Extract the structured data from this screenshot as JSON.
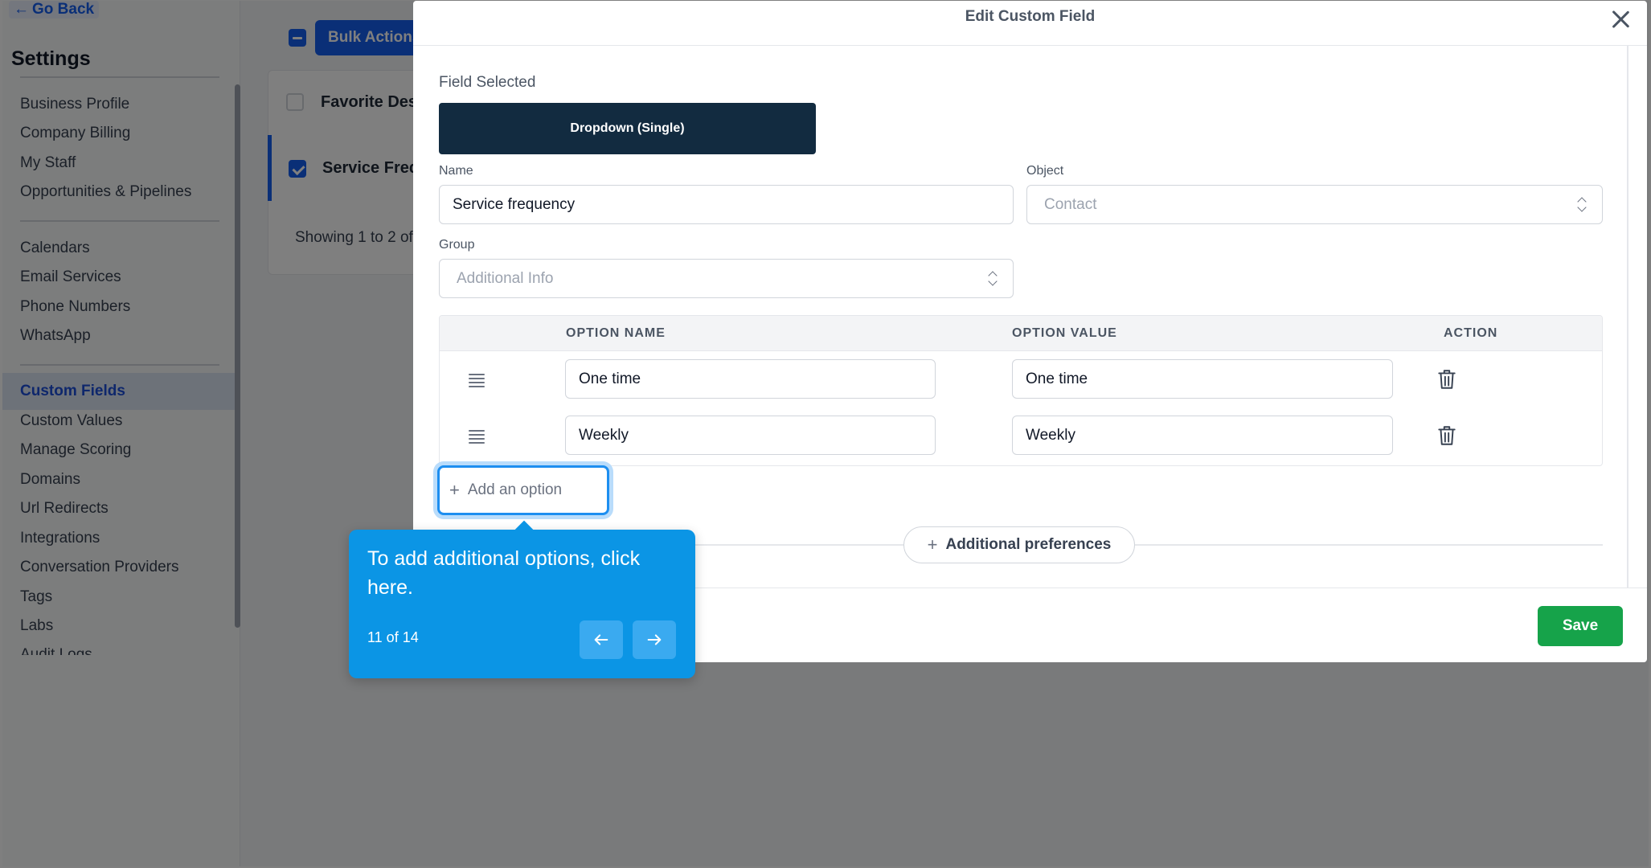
{
  "sidebar": {
    "go_back": "Go Back",
    "title": "Settings",
    "items": [
      {
        "label": "Business Profile"
      },
      {
        "label": "Company Billing"
      },
      {
        "label": "My Staff"
      },
      {
        "label": "Opportunities & Pipelines"
      },
      {
        "label": "Calendars"
      },
      {
        "label": "Email Services"
      },
      {
        "label": "Phone Numbers"
      },
      {
        "label": "WhatsApp"
      },
      {
        "label": "Custom Fields",
        "active": true
      },
      {
        "label": "Custom Values"
      },
      {
        "label": "Manage Scoring"
      },
      {
        "label": "Domains"
      },
      {
        "label": "Url Redirects"
      },
      {
        "label": "Integrations"
      },
      {
        "label": "Conversation Providers"
      },
      {
        "label": "Tags"
      },
      {
        "label": "Labs"
      },
      {
        "label": "Audit Logs"
      }
    ]
  },
  "list": {
    "bulk_actions": "Bulk Actions",
    "rows": [
      {
        "label": "Favorite Desc",
        "checked": false
      },
      {
        "label": "Service Freq",
        "checked": true
      }
    ],
    "showing": "Showing 1 to 2 of"
  },
  "modal": {
    "title": "Edit Custom Field",
    "field_selected_label": "Field Selected",
    "field_type": "Dropdown (Single)",
    "name_label": "Name",
    "name_value": "Service frequency",
    "object_label": "Object",
    "object_value": "Contact",
    "group_label": "Group",
    "group_value": "Additional Info",
    "options_table": {
      "headers": [
        "OPTION NAME",
        "OPTION VALUE",
        "ACTION"
      ],
      "rows": [
        {
          "name": "One time",
          "value": "One time"
        },
        {
          "name": "Weekly",
          "value": "Weekly"
        }
      ]
    },
    "add_option": "Add an option",
    "additional_preferences": "Additional preferences",
    "save": "Save"
  },
  "tooltip": {
    "text": "To add additional options, click here.",
    "step": "11 of 14"
  },
  "colors": {
    "primary": "#155eef",
    "field_type_bg": "#122b40",
    "save_green": "#16a34a",
    "tooltip_blue": "#0b95e5"
  }
}
